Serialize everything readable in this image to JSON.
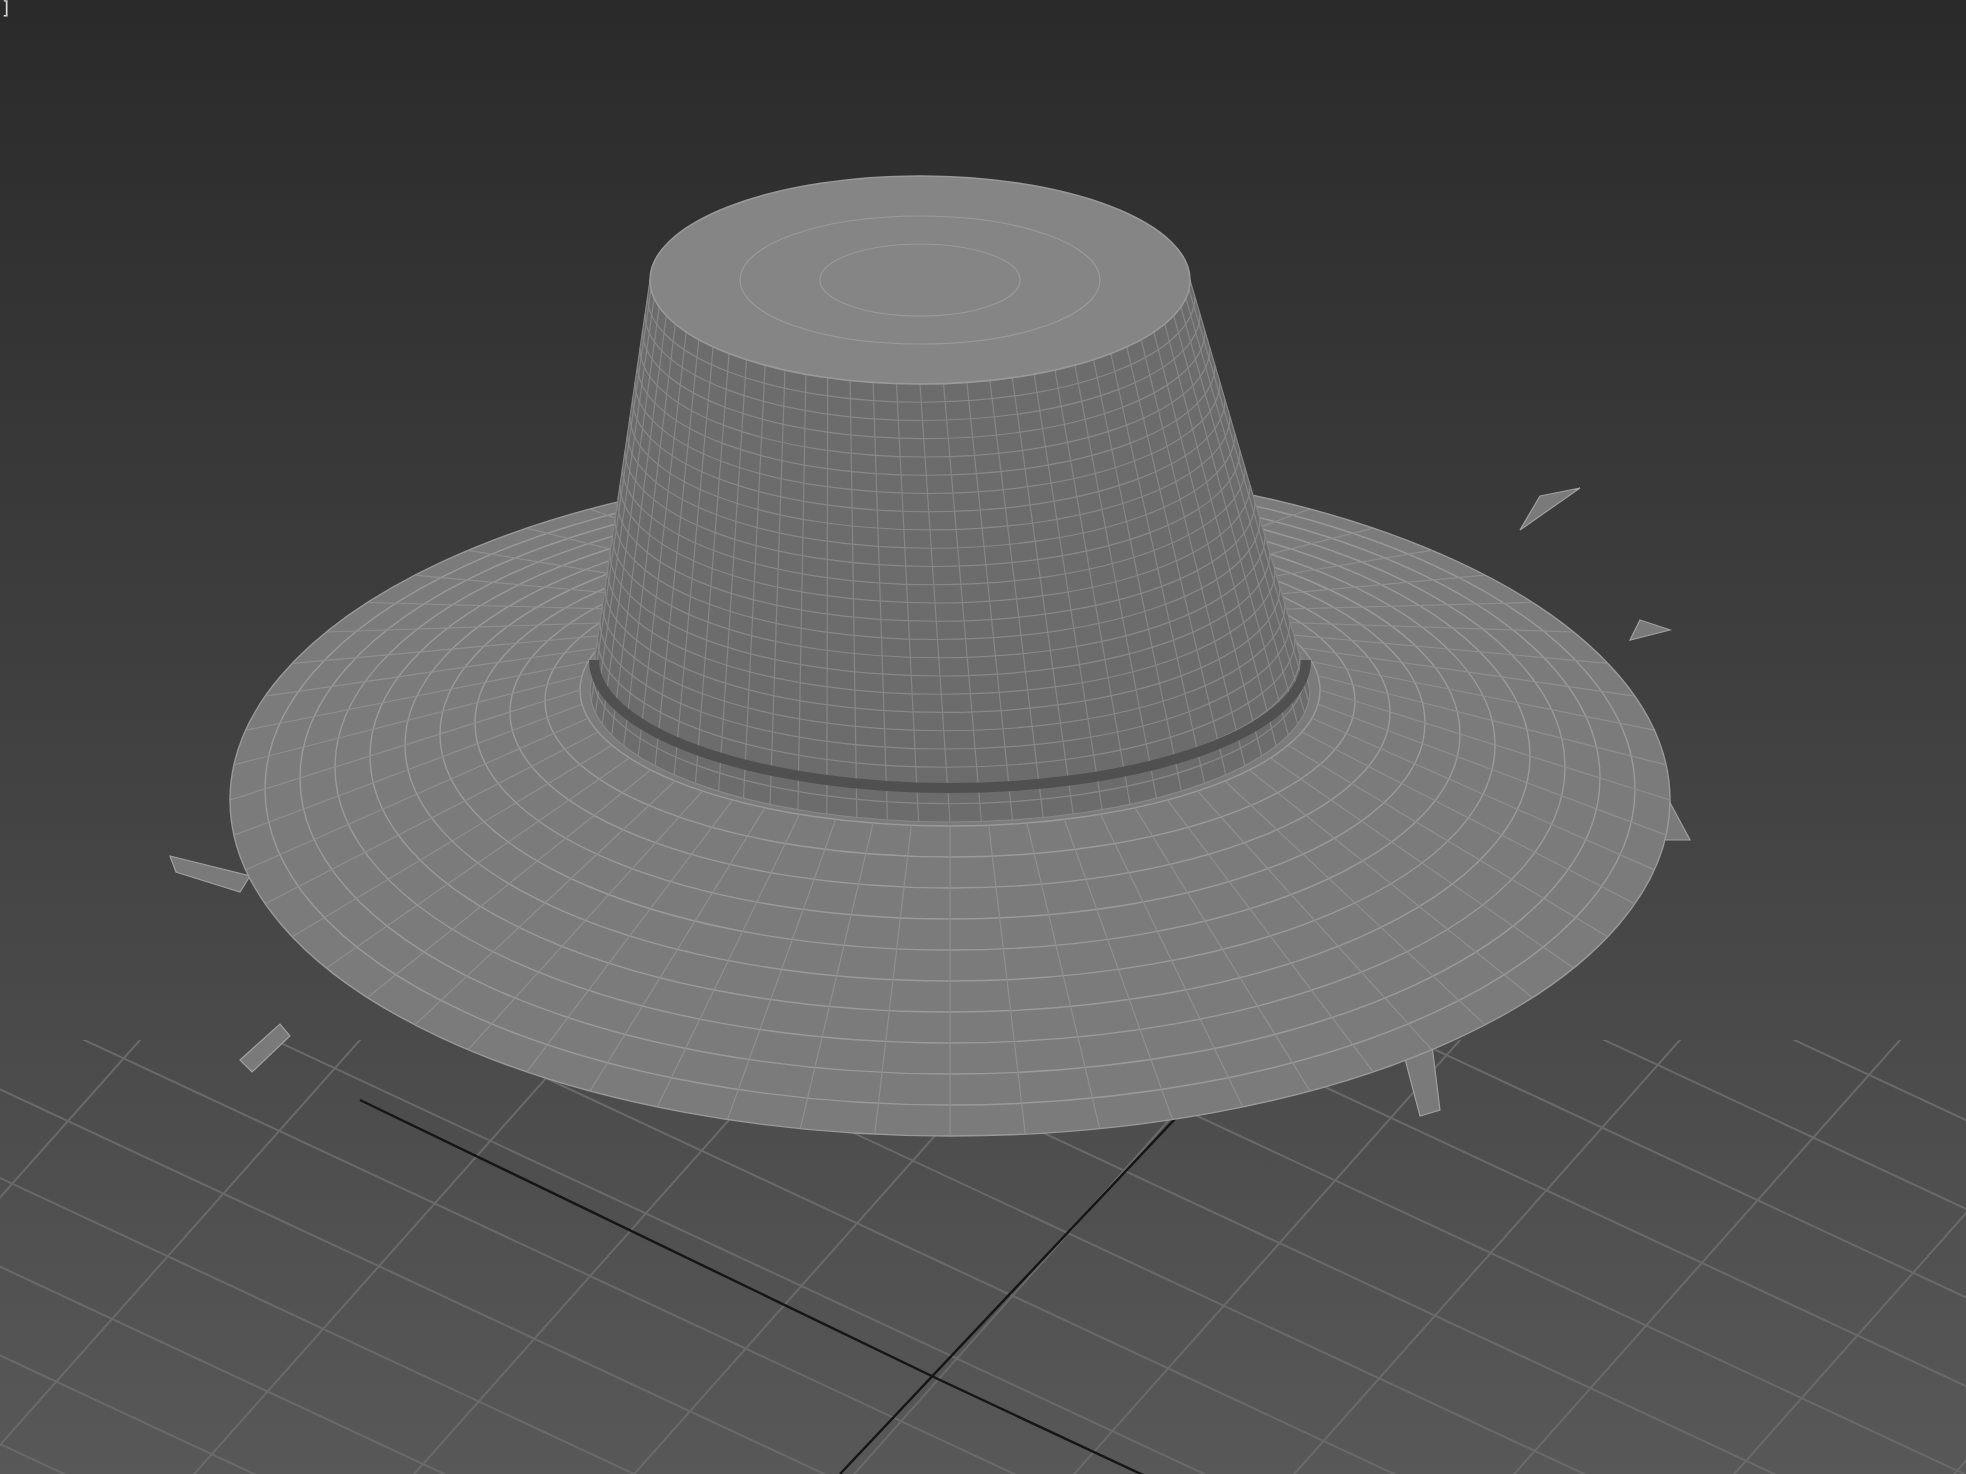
{
  "viewport": {
    "corner_label": "]"
  }
}
